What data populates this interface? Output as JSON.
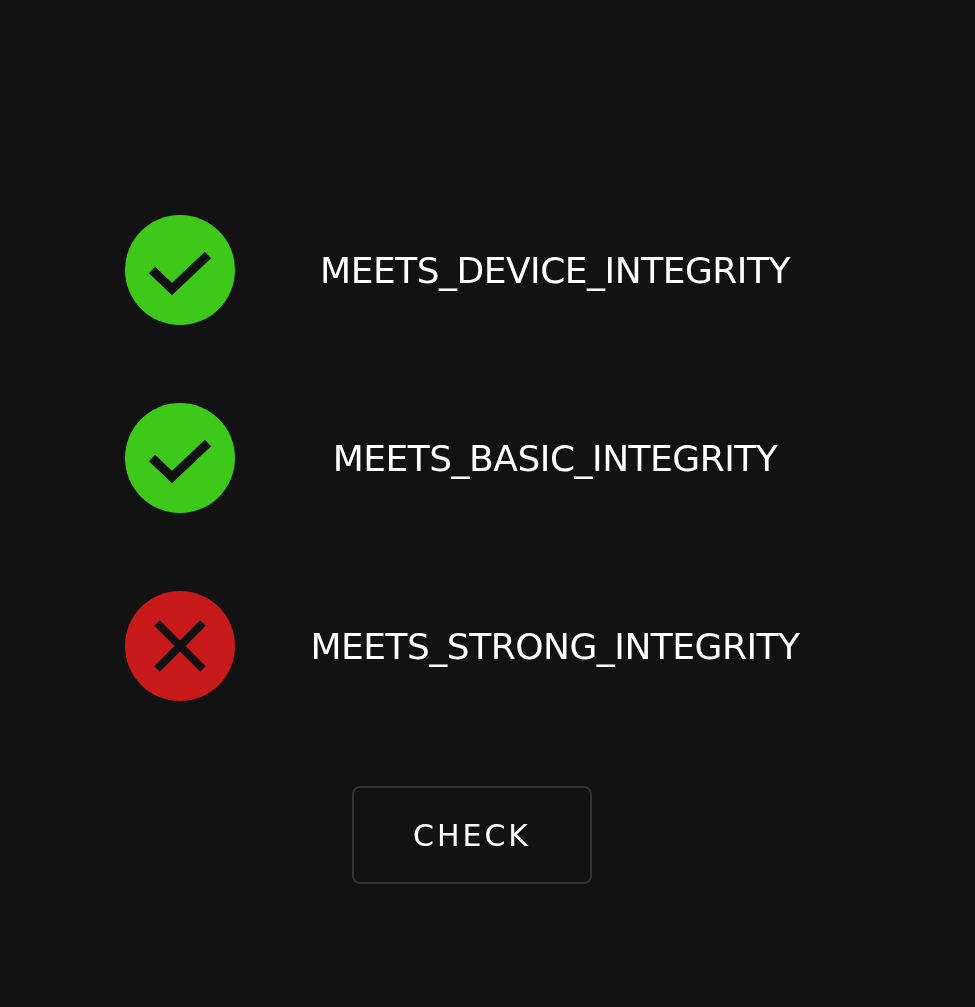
{
  "checks": [
    {
      "label": "MEETS_DEVICE_INTEGRITY",
      "passed": true
    },
    {
      "label": "MEETS_BASIC_INTEGRITY",
      "passed": true
    },
    {
      "label": "MEETS_STRONG_INTEGRITY",
      "passed": false
    }
  ],
  "button": "CHECK"
}
